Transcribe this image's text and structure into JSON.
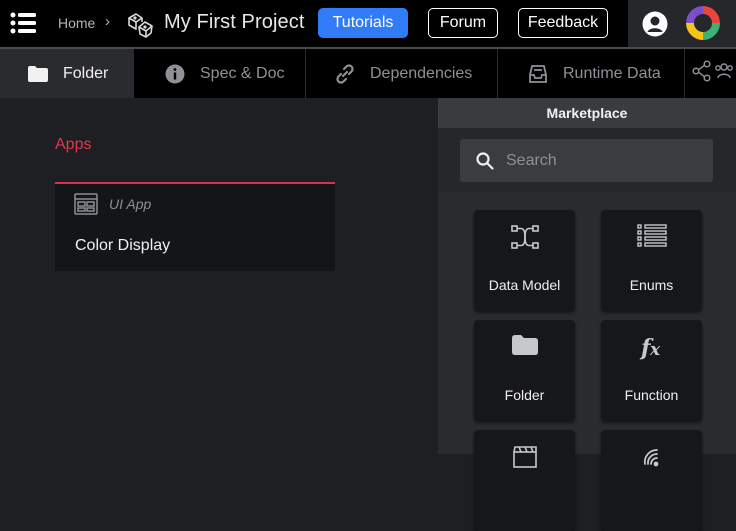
{
  "header": {
    "breadcrumb_home": "Home",
    "breadcrumb_separator": "›",
    "project_title": "My First Project",
    "tutorials_label": "Tutorials",
    "forum_label": "Forum",
    "feedback_label": "Feedback",
    "accent_color": "#2f7cf6"
  },
  "tabs": [
    {
      "label": "Folder",
      "icon": "folder-icon",
      "active": true
    },
    {
      "label": "Spec & Doc",
      "icon": "info-icon",
      "active": false
    },
    {
      "label": "Dependencies",
      "icon": "link-icon",
      "active": false
    },
    {
      "label": "Runtime Data",
      "icon": "inbox-icon",
      "active": false
    },
    {
      "label": "",
      "icon": "share-icon",
      "active": false
    }
  ],
  "main": {
    "section_title": "Apps",
    "section_color": "#e0384c",
    "apps": [
      {
        "type": "UI App",
        "name": "Color Display",
        "icon": "ui-app-icon"
      }
    ]
  },
  "marketplace": {
    "title": "Marketplace",
    "search_placeholder": "Search",
    "tiles": [
      {
        "label": "Data Model",
        "icon": "data-model-icon"
      },
      {
        "label": "Enums",
        "icon": "list-icon"
      },
      {
        "label": "Folder",
        "icon": "folder-icon"
      },
      {
        "label": "Function",
        "icon": "function-icon"
      },
      {
        "label": "",
        "icon": "clapperboard-icon"
      },
      {
        "label": "",
        "icon": "signal-icon"
      }
    ]
  }
}
